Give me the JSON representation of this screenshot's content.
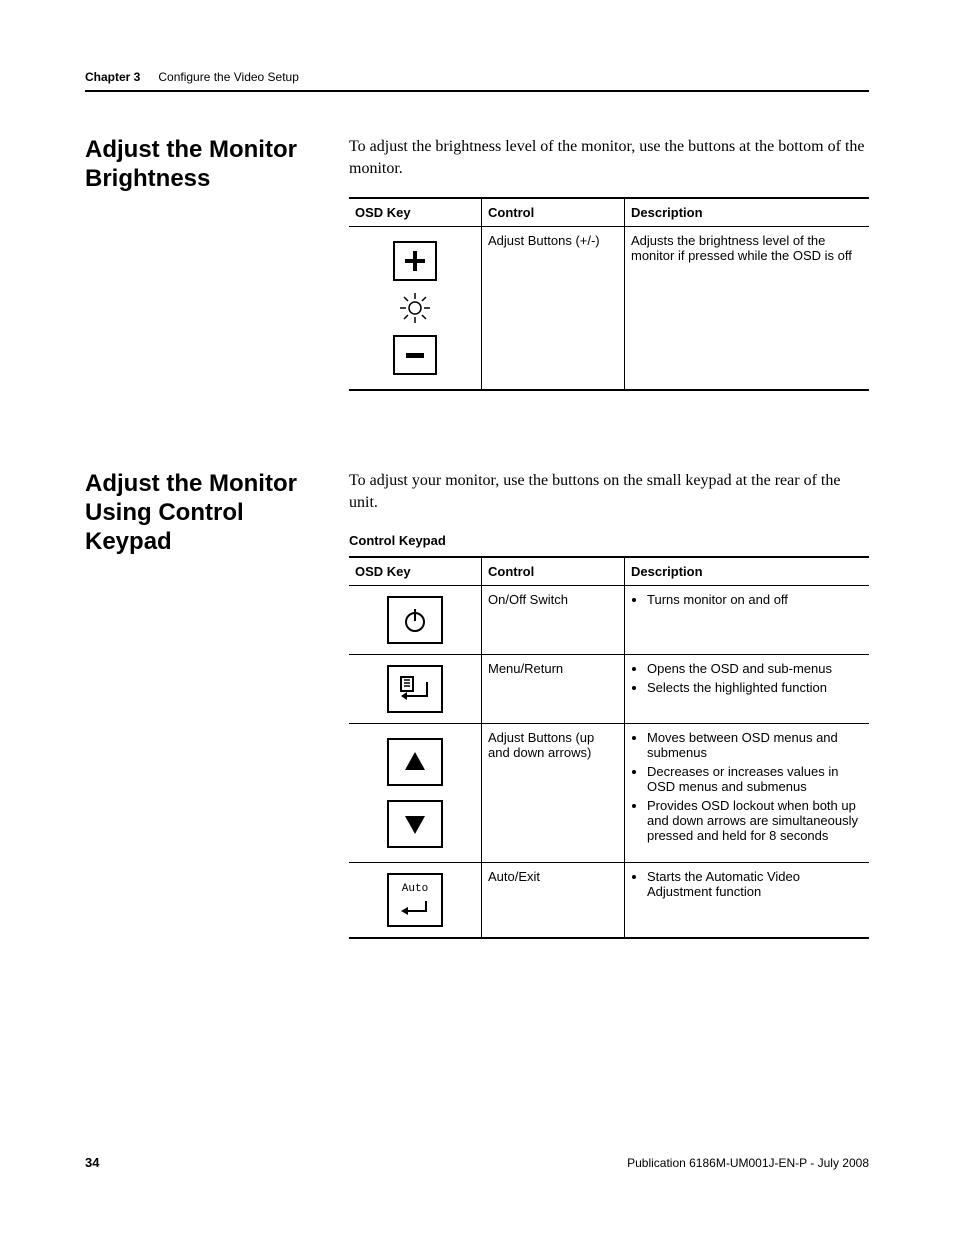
{
  "header": {
    "chapter": "Chapter 3",
    "title": "Configure the Video Setup"
  },
  "section1": {
    "heading": "Adjust the Monitor Brightness",
    "body": "To adjust the brightness level of the monitor, use the buttons at the bottom of the monitor.",
    "table": {
      "headers": {
        "c1": "OSD Key",
        "c2": "Control",
        "c3": "Description"
      },
      "rows": [
        {
          "icon": "plus-brightness-minus",
          "control": "Adjust Buttons (+/-)",
          "description": "Adjusts the brightness level of the monitor if pressed while the OSD is off"
        }
      ]
    }
  },
  "section2": {
    "heading": "Adjust the Monitor Using Control Keypad",
    "body": "To adjust your monitor, use the buttons on the small keypad at the rear of the unit.",
    "subtitle": "Control Keypad",
    "table": {
      "headers": {
        "c1": "OSD Key",
        "c2": "Control",
        "c3": "Description"
      },
      "rows": [
        {
          "icon": "power",
          "control": "On/Off Switch",
          "description_items": [
            "Turns monitor on and off"
          ]
        },
        {
          "icon": "menu-return",
          "control": "Menu/Return",
          "description_items": [
            "Opens the OSD and sub-menus",
            "Selects the highlighted function"
          ]
        },
        {
          "icon": "up-down",
          "control": "Adjust Buttons (up and down arrows)",
          "description_items": [
            "Moves between OSD menus and submenus",
            "Decreases or increases values in OSD menus and submenus",
            "Provides OSD lockout when both up and down arrows are simultaneously pressed and held for 8 seconds"
          ]
        },
        {
          "icon": "auto-exit",
          "control": "Auto/Exit",
          "description_items": [
            "Starts the Automatic Video Adjustment function"
          ]
        }
      ]
    }
  },
  "footer": {
    "page": "34",
    "pub": "Publication 6186M-UM001J-EN-P - July 2008"
  }
}
